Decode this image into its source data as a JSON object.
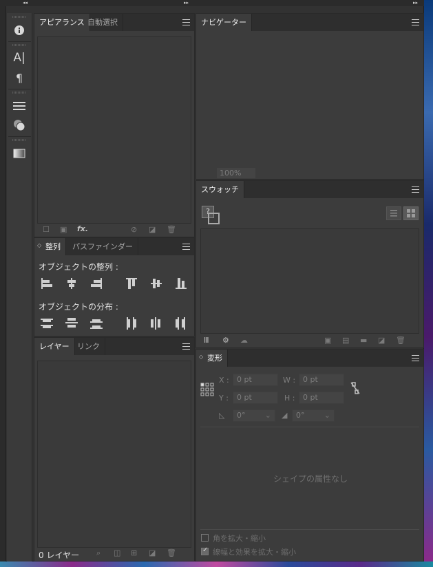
{
  "titlebar": {
    "collapse_left": "◂◂",
    "collapse_mid": "▸▸",
    "collapse_right": "▸▸"
  },
  "appearance": {
    "tabs": [
      "アピアランス",
      "自動選択"
    ],
    "footer_icons": [
      "add-stroke",
      "add-fill",
      "fx",
      "clear",
      "duplicate",
      "delete"
    ],
    "fx_label": "fx."
  },
  "align": {
    "tabs": [
      "整列",
      "パスファインダー"
    ],
    "align_objects_label": "オブジェクトの整列 :",
    "distribute_objects_label": "オブジェクトの分布 :"
  },
  "layers": {
    "tabs": [
      "レイヤー",
      "リンク"
    ],
    "count_label": "0 レイヤー"
  },
  "navigator": {
    "tabs": [
      "ナビゲーター"
    ],
    "zoom": "100%"
  },
  "swatches": {
    "tabs": [
      "スウォッチ"
    ],
    "unknown_swatch": "?"
  },
  "transform": {
    "tabs": [
      "変形"
    ],
    "x_label": "X :",
    "x_value": "0 pt",
    "y_label": "Y :",
    "y_value": "0 pt",
    "w_label": "W :",
    "w_value": "0 pt",
    "h_label": "H :",
    "h_value": "0 pt",
    "angle_value": "0°",
    "shear_value": "0°",
    "empty_message": "シェイプの属性なし",
    "scale_corners_label": "角を拡大・縮小",
    "scale_strokes_label": "線幅と効果を拡大・縮小",
    "scale_corners_checked": false,
    "scale_strokes_checked": true
  },
  "tools": [
    "info-icon",
    "character-icon",
    "paragraph-icon",
    "stroke-icon",
    "color-guide-icon",
    "gradient-icon"
  ]
}
